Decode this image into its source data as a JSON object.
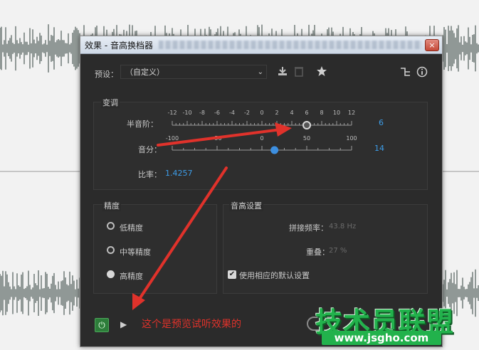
{
  "dialog": {
    "title": "效果 - 音高换档器",
    "close_label": "×"
  },
  "preset": {
    "label": "预设：",
    "value": "（自定义）"
  },
  "transpose": {
    "title": "变调",
    "semitone_label": "半音阶：",
    "semitone_ticks": [
      "-12",
      "-10",
      "-8",
      "-6",
      "-4",
      "-2",
      "0",
      "2",
      "4",
      "6",
      "8",
      "10",
      "12"
    ],
    "semitone_value": "6",
    "cents_label": "音分：",
    "cents_ticks": [
      "-100",
      "-50",
      "0",
      "50",
      "100"
    ],
    "cents_value": "14",
    "ratio_label": "比率：",
    "ratio_value": "1.4257"
  },
  "precision": {
    "title": "精度",
    "options": [
      {
        "label": "低精度",
        "selected": false
      },
      {
        "label": "中等精度",
        "selected": false
      },
      {
        "label": "高精度",
        "selected": true
      }
    ]
  },
  "pitch_settings": {
    "title": "音高设置",
    "splice_label": "拼接频率：",
    "splice_value": "43.8 Hz",
    "overlap_label": "重叠：",
    "overlap_value": "27 %",
    "default_checkbox_label": "使用相应的默认设置",
    "default_checked": true
  },
  "annotation": {
    "text": "这个是预览试听效果的"
  },
  "watermark": {
    "main": "技术员联盟",
    "url": "www.jsgho.com"
  },
  "colors": {
    "accent_blue": "#3d9de8",
    "annotation_red": "#e0322b",
    "watermark_green": "#22b24c"
  }
}
